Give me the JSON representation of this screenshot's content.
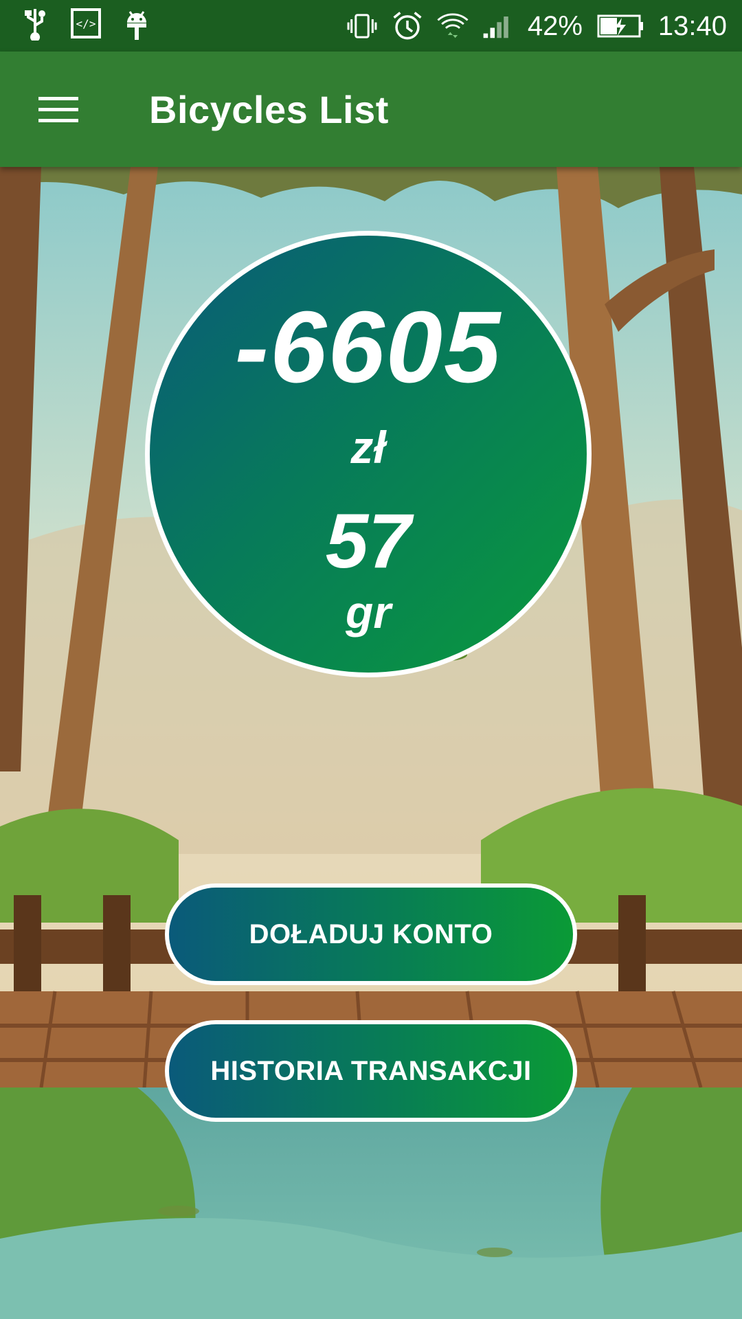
{
  "status_bar": {
    "icons_left": [
      "usb-icon",
      "code-icon",
      "android-icon"
    ],
    "icons_right": [
      "vibrate-icon",
      "alarm-icon",
      "wifi-icon",
      "signal-icon",
      "battery-charging-icon"
    ],
    "battery_percent": "42%",
    "time": "13:40"
  },
  "app_bar": {
    "menu_icon": "hamburger-menu-icon",
    "title": "Bicycles List"
  },
  "balance": {
    "amount": "-6605",
    "currency": "zł",
    "minor": "57",
    "minor_unit": "gr"
  },
  "actions": {
    "top_up": "DOŁADUJ KONTO",
    "history": "HISTORIA TRANSAKCJI"
  },
  "colors": {
    "status_bar": "#1b5e20",
    "app_bar": "#327e32",
    "gradient_start": "#0a5a7a",
    "gradient_end": "#0a9a3c"
  }
}
